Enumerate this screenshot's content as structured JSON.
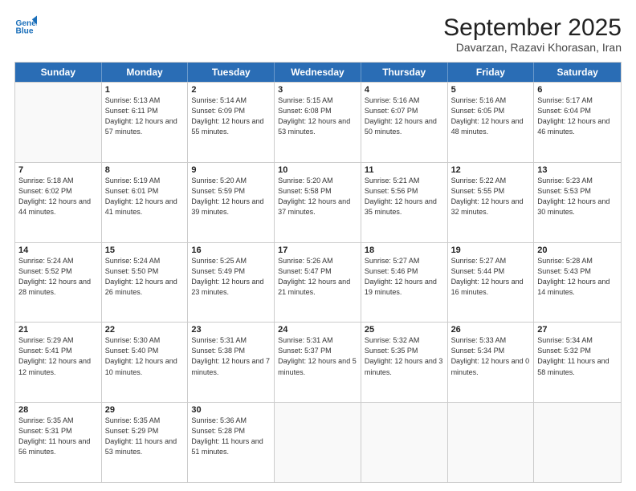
{
  "header": {
    "logo_line1": "General",
    "logo_line2": "Blue",
    "month_title": "September 2025",
    "location": "Davarzan, Razavi Khorasan, Iran"
  },
  "days_of_week": [
    "Sunday",
    "Monday",
    "Tuesday",
    "Wednesday",
    "Thursday",
    "Friday",
    "Saturday"
  ],
  "weeks": [
    [
      {
        "day": "",
        "sunrise": "",
        "sunset": "",
        "daylight": ""
      },
      {
        "day": "1",
        "sunrise": "Sunrise: 5:13 AM",
        "sunset": "Sunset: 6:11 PM",
        "daylight": "Daylight: 12 hours and 57 minutes."
      },
      {
        "day": "2",
        "sunrise": "Sunrise: 5:14 AM",
        "sunset": "Sunset: 6:09 PM",
        "daylight": "Daylight: 12 hours and 55 minutes."
      },
      {
        "day": "3",
        "sunrise": "Sunrise: 5:15 AM",
        "sunset": "Sunset: 6:08 PM",
        "daylight": "Daylight: 12 hours and 53 minutes."
      },
      {
        "day": "4",
        "sunrise": "Sunrise: 5:16 AM",
        "sunset": "Sunset: 6:07 PM",
        "daylight": "Daylight: 12 hours and 50 minutes."
      },
      {
        "day": "5",
        "sunrise": "Sunrise: 5:16 AM",
        "sunset": "Sunset: 6:05 PM",
        "daylight": "Daylight: 12 hours and 48 minutes."
      },
      {
        "day": "6",
        "sunrise": "Sunrise: 5:17 AM",
        "sunset": "Sunset: 6:04 PM",
        "daylight": "Daylight: 12 hours and 46 minutes."
      }
    ],
    [
      {
        "day": "7",
        "sunrise": "Sunrise: 5:18 AM",
        "sunset": "Sunset: 6:02 PM",
        "daylight": "Daylight: 12 hours and 44 minutes."
      },
      {
        "day": "8",
        "sunrise": "Sunrise: 5:19 AM",
        "sunset": "Sunset: 6:01 PM",
        "daylight": "Daylight: 12 hours and 41 minutes."
      },
      {
        "day": "9",
        "sunrise": "Sunrise: 5:20 AM",
        "sunset": "Sunset: 5:59 PM",
        "daylight": "Daylight: 12 hours and 39 minutes."
      },
      {
        "day": "10",
        "sunrise": "Sunrise: 5:20 AM",
        "sunset": "Sunset: 5:58 PM",
        "daylight": "Daylight: 12 hours and 37 minutes."
      },
      {
        "day": "11",
        "sunrise": "Sunrise: 5:21 AM",
        "sunset": "Sunset: 5:56 PM",
        "daylight": "Daylight: 12 hours and 35 minutes."
      },
      {
        "day": "12",
        "sunrise": "Sunrise: 5:22 AM",
        "sunset": "Sunset: 5:55 PM",
        "daylight": "Daylight: 12 hours and 32 minutes."
      },
      {
        "day": "13",
        "sunrise": "Sunrise: 5:23 AM",
        "sunset": "Sunset: 5:53 PM",
        "daylight": "Daylight: 12 hours and 30 minutes."
      }
    ],
    [
      {
        "day": "14",
        "sunrise": "Sunrise: 5:24 AM",
        "sunset": "Sunset: 5:52 PM",
        "daylight": "Daylight: 12 hours and 28 minutes."
      },
      {
        "day": "15",
        "sunrise": "Sunrise: 5:24 AM",
        "sunset": "Sunset: 5:50 PM",
        "daylight": "Daylight: 12 hours and 26 minutes."
      },
      {
        "day": "16",
        "sunrise": "Sunrise: 5:25 AM",
        "sunset": "Sunset: 5:49 PM",
        "daylight": "Daylight: 12 hours and 23 minutes."
      },
      {
        "day": "17",
        "sunrise": "Sunrise: 5:26 AM",
        "sunset": "Sunset: 5:47 PM",
        "daylight": "Daylight: 12 hours and 21 minutes."
      },
      {
        "day": "18",
        "sunrise": "Sunrise: 5:27 AM",
        "sunset": "Sunset: 5:46 PM",
        "daylight": "Daylight: 12 hours and 19 minutes."
      },
      {
        "day": "19",
        "sunrise": "Sunrise: 5:27 AM",
        "sunset": "Sunset: 5:44 PM",
        "daylight": "Daylight: 12 hours and 16 minutes."
      },
      {
        "day": "20",
        "sunrise": "Sunrise: 5:28 AM",
        "sunset": "Sunset: 5:43 PM",
        "daylight": "Daylight: 12 hours and 14 minutes."
      }
    ],
    [
      {
        "day": "21",
        "sunrise": "Sunrise: 5:29 AM",
        "sunset": "Sunset: 5:41 PM",
        "daylight": "Daylight: 12 hours and 12 minutes."
      },
      {
        "day": "22",
        "sunrise": "Sunrise: 5:30 AM",
        "sunset": "Sunset: 5:40 PM",
        "daylight": "Daylight: 12 hours and 10 minutes."
      },
      {
        "day": "23",
        "sunrise": "Sunrise: 5:31 AM",
        "sunset": "Sunset: 5:38 PM",
        "daylight": "Daylight: 12 hours and 7 minutes."
      },
      {
        "day": "24",
        "sunrise": "Sunrise: 5:31 AM",
        "sunset": "Sunset: 5:37 PM",
        "daylight": "Daylight: 12 hours and 5 minutes."
      },
      {
        "day": "25",
        "sunrise": "Sunrise: 5:32 AM",
        "sunset": "Sunset: 5:35 PM",
        "daylight": "Daylight: 12 hours and 3 minutes."
      },
      {
        "day": "26",
        "sunrise": "Sunrise: 5:33 AM",
        "sunset": "Sunset: 5:34 PM",
        "daylight": "Daylight: 12 hours and 0 minutes."
      },
      {
        "day": "27",
        "sunrise": "Sunrise: 5:34 AM",
        "sunset": "Sunset: 5:32 PM",
        "daylight": "Daylight: 11 hours and 58 minutes."
      }
    ],
    [
      {
        "day": "28",
        "sunrise": "Sunrise: 5:35 AM",
        "sunset": "Sunset: 5:31 PM",
        "daylight": "Daylight: 11 hours and 56 minutes."
      },
      {
        "day": "29",
        "sunrise": "Sunrise: 5:35 AM",
        "sunset": "Sunset: 5:29 PM",
        "daylight": "Daylight: 11 hours and 53 minutes."
      },
      {
        "day": "30",
        "sunrise": "Sunrise: 5:36 AM",
        "sunset": "Sunset: 5:28 PM",
        "daylight": "Daylight: 11 hours and 51 minutes."
      },
      {
        "day": "",
        "sunrise": "",
        "sunset": "",
        "daylight": ""
      },
      {
        "day": "",
        "sunrise": "",
        "sunset": "",
        "daylight": ""
      },
      {
        "day": "",
        "sunrise": "",
        "sunset": "",
        "daylight": ""
      },
      {
        "day": "",
        "sunrise": "",
        "sunset": "",
        "daylight": ""
      }
    ]
  ]
}
